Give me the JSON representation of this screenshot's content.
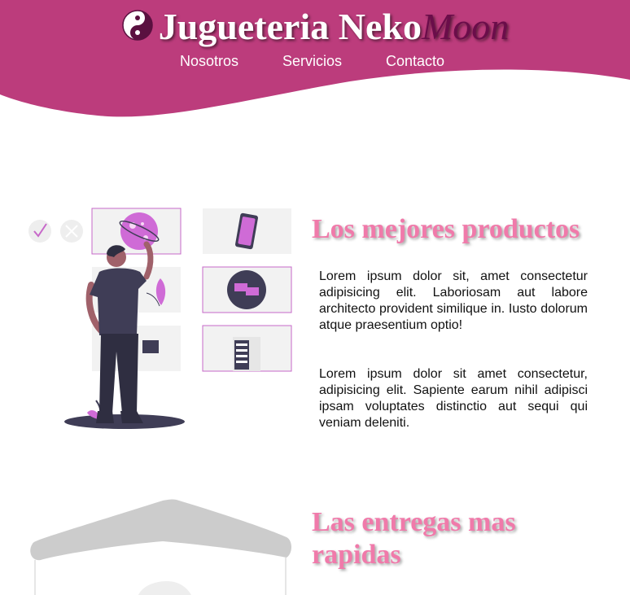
{
  "header": {
    "brand_main": "Jugueteria Neko",
    "brand_accent": "Moon",
    "colors": {
      "primary": "#bc3c7c",
      "accent_text": "#6a0d4a"
    },
    "nav": [
      {
        "label": "Nosotros"
      },
      {
        "label": "Servicios"
      },
      {
        "label": "Contacto"
      }
    ]
  },
  "sections": [
    {
      "title": "Los mejores productos",
      "paragraphs": [
        "Lorem ipsum dolor sit, amet consectetur adipisicing elit. Laboriosam aut labore architecto provident similique in. Iusto dolorum atque praesentium optio!",
        "Lorem ipsum dolor sit amet consectetur, adipisicing elit. Sapiente earum nihil adipisci ipsam voluptates distinctio aut sequi qui veniam deleniti."
      ]
    },
    {
      "title": "Las entregas mas rapidas"
    }
  ],
  "icons": [
    "yin-yang-icon",
    "check-icon",
    "close-icon",
    "planet-icon",
    "phone-icon",
    "chat-icon",
    "building-icon"
  ],
  "title_color": "#f07aaa"
}
